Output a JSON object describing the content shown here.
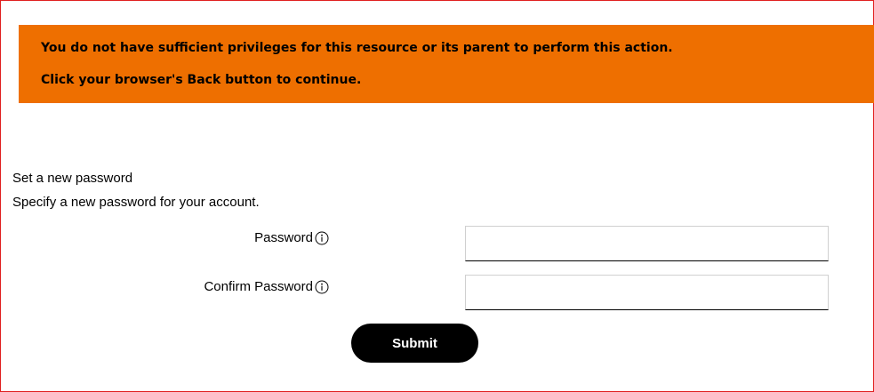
{
  "alert": {
    "line1": "You do not have sufficient privileges for this resource or its parent to perform this action.",
    "line2": "Click your browser's Back button to continue.",
    "background_color": "#ee6f00"
  },
  "form": {
    "heading": "Set a new password",
    "subheading": "Specify a new password for your account.",
    "fields": [
      {
        "label": "Password",
        "icon": "info-icon",
        "value": ""
      },
      {
        "label": "Confirm Password",
        "icon": "info-icon",
        "value": ""
      }
    ],
    "submit_label": "Submit"
  },
  "colors": {
    "border": "#e02020",
    "button": "#000000",
    "button_text": "#ffffff"
  }
}
